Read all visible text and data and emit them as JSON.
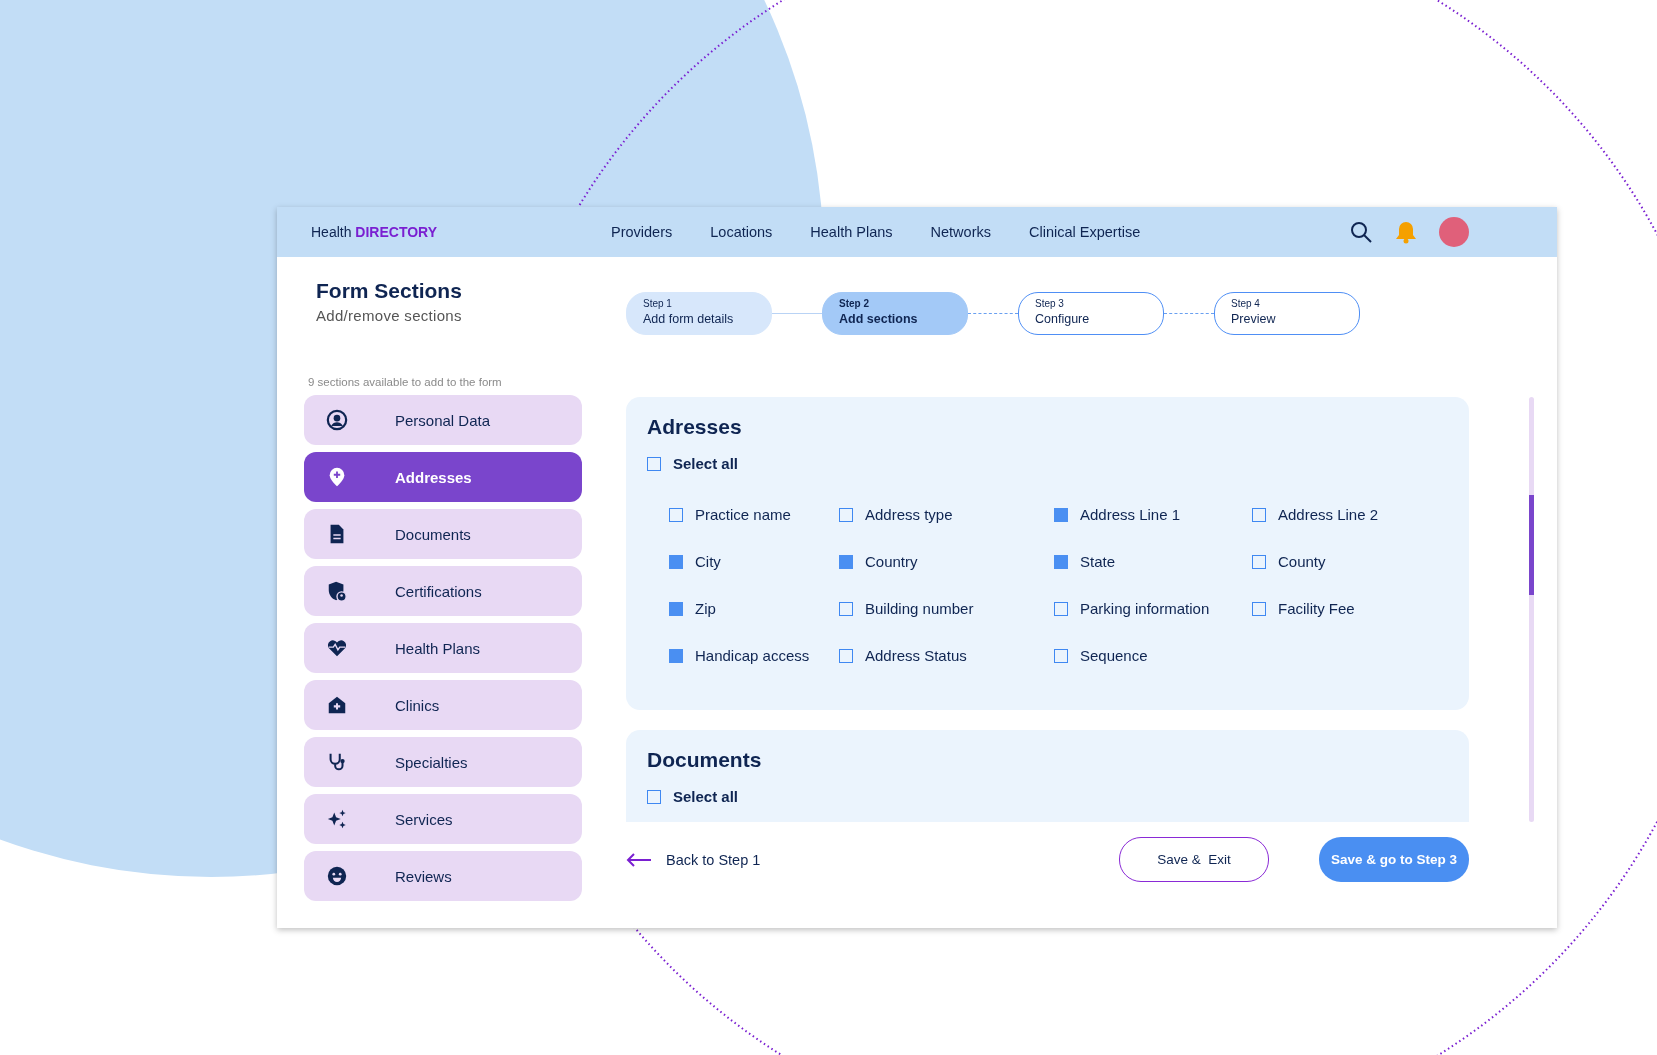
{
  "header": {
    "brand": "Health",
    "brand_highlight": "DIRECTORY",
    "nav": [
      "Providers",
      "Locations",
      "Health Plans",
      "Networks",
      "Clinical Expertise"
    ]
  },
  "page": {
    "title": "Form Sections",
    "subtitle": "Add/remove sections"
  },
  "steps": [
    {
      "step": "Step 1",
      "label": "Add form details",
      "completed": true,
      "selected": false
    },
    {
      "step": "Step 2",
      "label": "Add sections",
      "completed": false,
      "selected": true
    },
    {
      "step": "Step 3",
      "label": "Configure",
      "completed": false,
      "selected": false
    },
    {
      "step": "Step 4",
      "label": "Preview",
      "completed": false,
      "selected": false
    }
  ],
  "sidebar": {
    "caption": "9 sections available to add to the form",
    "items": [
      {
        "label": "Personal Data",
        "selected": false
      },
      {
        "label": "Addresses",
        "selected": true
      },
      {
        "label": "Documents",
        "selected": false
      },
      {
        "label": "Certifications",
        "selected": false
      },
      {
        "label": "Health Plans",
        "selected": false
      },
      {
        "label": "Clinics",
        "selected": false
      },
      {
        "label": "Specialties",
        "selected": false
      },
      {
        "label": "Services",
        "selected": false
      },
      {
        "label": "Reviews",
        "selected": false
      }
    ]
  },
  "sections": [
    {
      "title": "Adresses",
      "select_all": {
        "label": "Select all",
        "checked": false
      },
      "fields": [
        {
          "label": "Practice name",
          "checked": false
        },
        {
          "label": "Address type",
          "checked": false
        },
        {
          "label": "Address Line 1",
          "checked": true
        },
        {
          "label": "Address Line 2",
          "checked": false
        },
        {
          "label": "City",
          "checked": true
        },
        {
          "label": "Country",
          "checked": true
        },
        {
          "label": "State",
          "checked": true
        },
        {
          "label": "County",
          "checked": false
        },
        {
          "label": "Zip",
          "checked": true
        },
        {
          "label": "Building number",
          "checked": false
        },
        {
          "label": "Parking information",
          "checked": false
        },
        {
          "label": "Facility Fee",
          "checked": false
        },
        {
          "label": "Handicap access",
          "checked": true
        },
        {
          "label": "Address Status",
          "checked": false
        },
        {
          "label": "Sequence",
          "checked": false
        }
      ]
    },
    {
      "title": "Documents",
      "select_all": {
        "label": "Select all",
        "checked": false
      }
    }
  ],
  "footer": {
    "back": "Back to Step 1",
    "save_exit": "Save &  Exit",
    "next": "Save & go to Step 3"
  }
}
